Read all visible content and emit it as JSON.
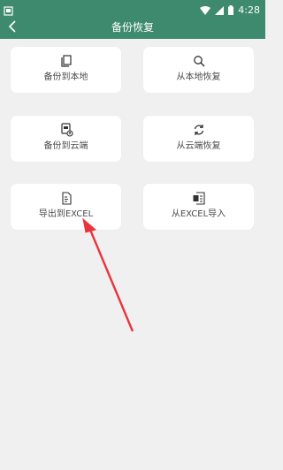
{
  "status_bar": {
    "time": "4:28"
  },
  "app_bar": {
    "title": "备份恢复"
  },
  "cards": [
    {
      "label": "备份到本地",
      "icon": "copy-icon"
    },
    {
      "label": "从本地恢复",
      "icon": "search-icon"
    },
    {
      "label": "备份到云端",
      "icon": "cloud-upload-icon"
    },
    {
      "label": "从云端恢复",
      "icon": "refresh-icon"
    },
    {
      "label": "导出到EXCEL",
      "icon": "export-file-icon"
    },
    {
      "label": "从EXCEL导入",
      "icon": "import-file-icon"
    }
  ],
  "colors": {
    "primary": "#3e8a6e",
    "background": "#f0f0f0",
    "annotation_arrow": "#e8343a"
  }
}
